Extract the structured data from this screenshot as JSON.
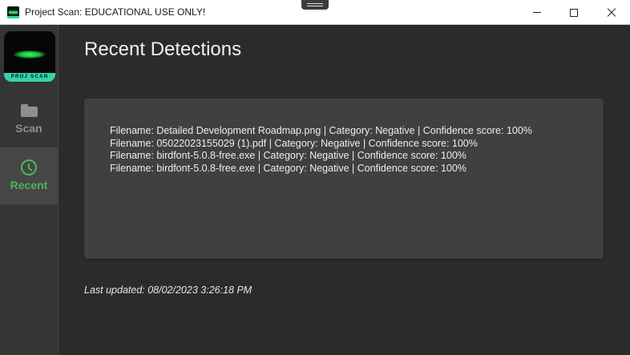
{
  "window": {
    "title": "Project Scan: EDUCATIONAL USE ONLY!"
  },
  "sidebar": {
    "logo_text": "PROJ SCAN",
    "items": [
      {
        "label": "Scan",
        "icon": "folder-icon",
        "active": false
      },
      {
        "label": "Recent",
        "icon": "clock-icon",
        "active": true
      }
    ]
  },
  "main": {
    "title": "Recent Detections",
    "detections": [
      "Filename: Detailed Development Roadmap.png | Category: Negative | Confidence score: 100%",
      "Filename: 05022023155029 (1).pdf | Category: Negative | Confidence score: 100%",
      "Filename: birdfont-5.0.8-free.exe | Category: Negative | Confidence score: 100%",
      "Filename: birdfont-5.0.8-free.exe | Category: Negative | Confidence score: 100%"
    ],
    "last_updated": "Last updated: 08/02/2023 3:26:18 PM"
  },
  "colors": {
    "background": "#2b2b2b",
    "sidebar": "#353535",
    "panel": "#404040",
    "accent": "#4fb55a",
    "logo_accent": "#34d3aa"
  }
}
